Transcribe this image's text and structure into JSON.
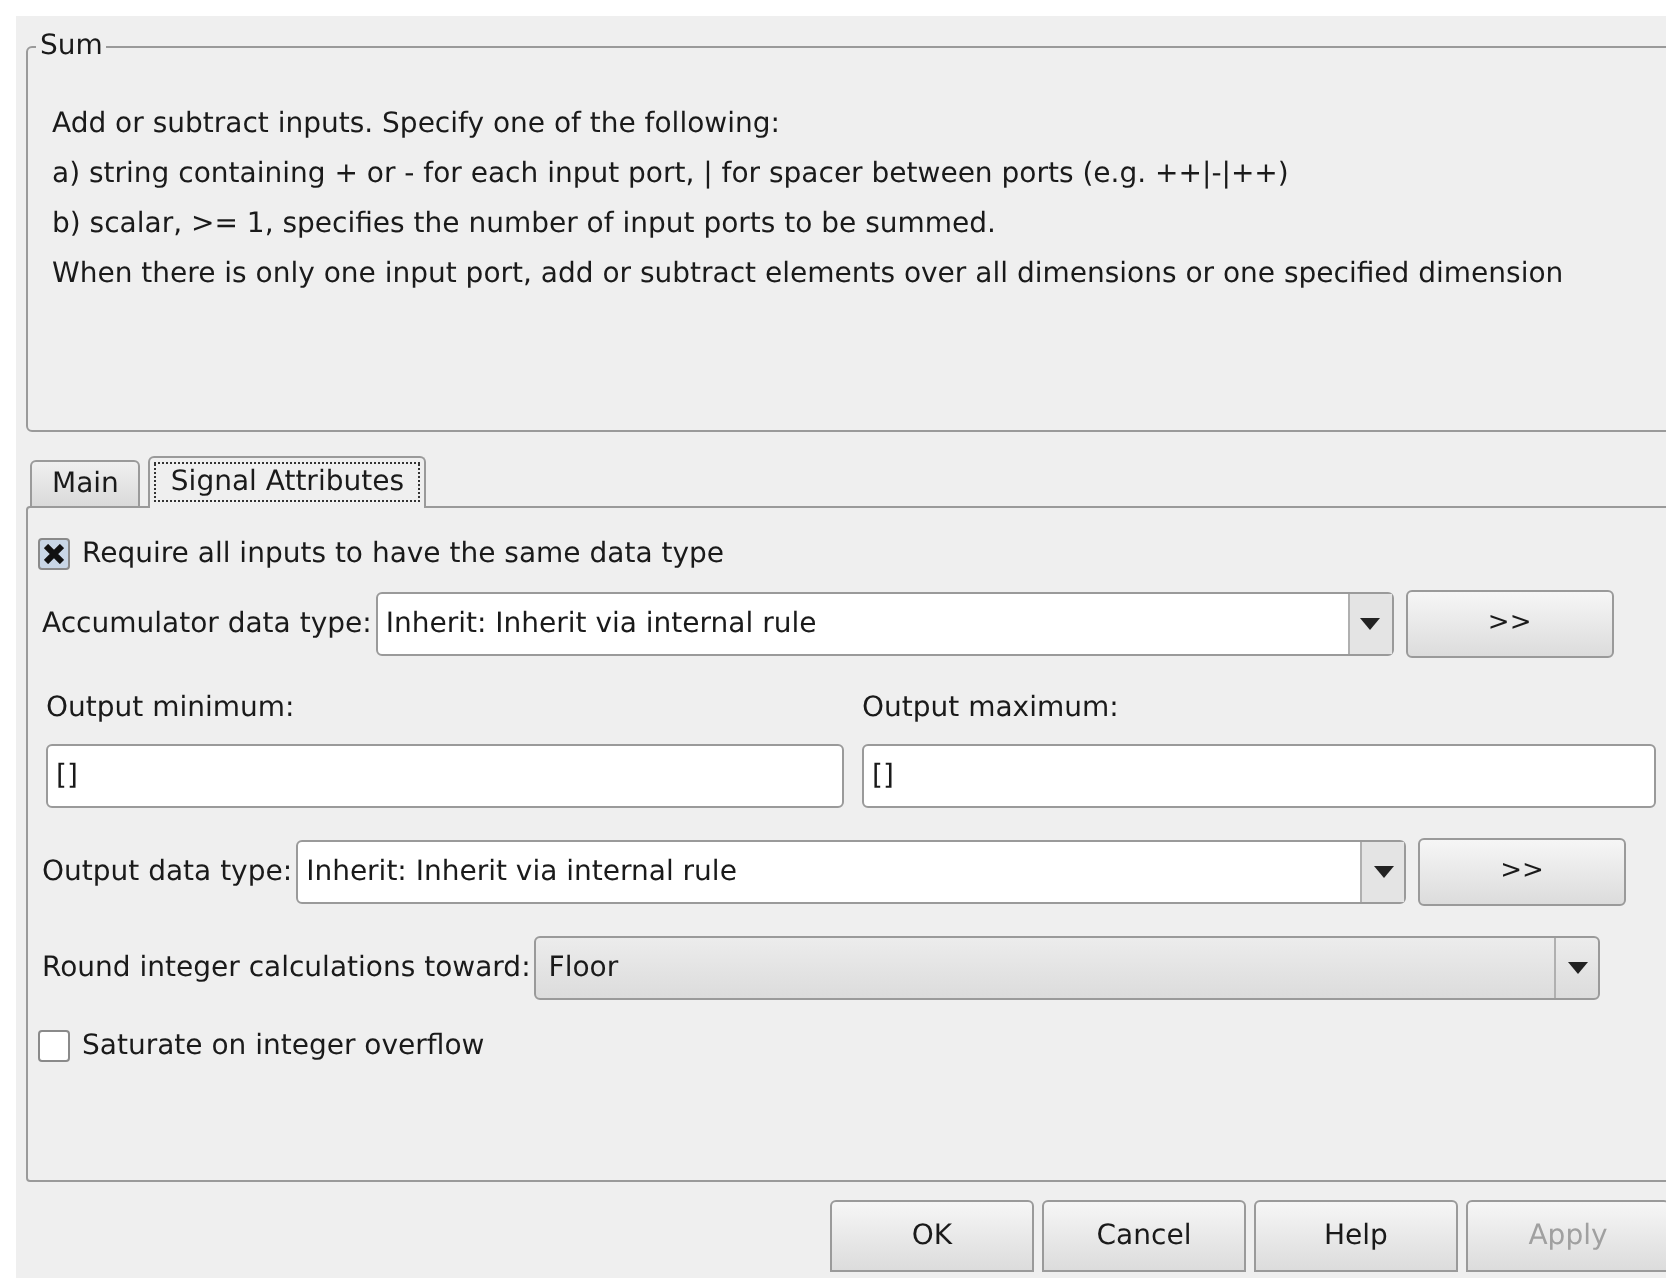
{
  "group": {
    "title": "Sum",
    "description": [
      "Add or subtract inputs.  Specify one of the following:",
      "a) string containing + or - for each input port, | for spacer between ports (e.g. ++|-|++)",
      "b) scalar, >= 1, specifies the number of input ports to be summed.",
      "When there is only one input port, add or subtract elements over all dimensions or one specified dimension"
    ]
  },
  "tabs": [
    {
      "label": "Main",
      "selected": false
    },
    {
      "label": "Signal Attributes",
      "selected": true
    }
  ],
  "require_same_type": {
    "label": "Require all inputs to have the same data type",
    "checked": true
  },
  "accumulator": {
    "label": "Accumulator data type:",
    "value": "Inherit: Inherit via internal rule",
    "button": ">>"
  },
  "output_minimum": {
    "label": "Output minimum:",
    "value": "[]"
  },
  "output_maximum": {
    "label": "Output maximum:",
    "value": "[]"
  },
  "output_type": {
    "label": "Output data type:",
    "value": "Inherit: Inherit via internal rule",
    "button": ">>"
  },
  "rounding": {
    "label": "Round integer calculations toward:",
    "value": "Floor"
  },
  "saturate": {
    "label": "Saturate on integer overflow",
    "checked": false
  },
  "buttons": [
    {
      "label": "OK",
      "disabled": false
    },
    {
      "label": "Cancel",
      "disabled": false
    },
    {
      "label": "Help",
      "disabled": false
    },
    {
      "label": "Apply",
      "disabled": true
    }
  ]
}
